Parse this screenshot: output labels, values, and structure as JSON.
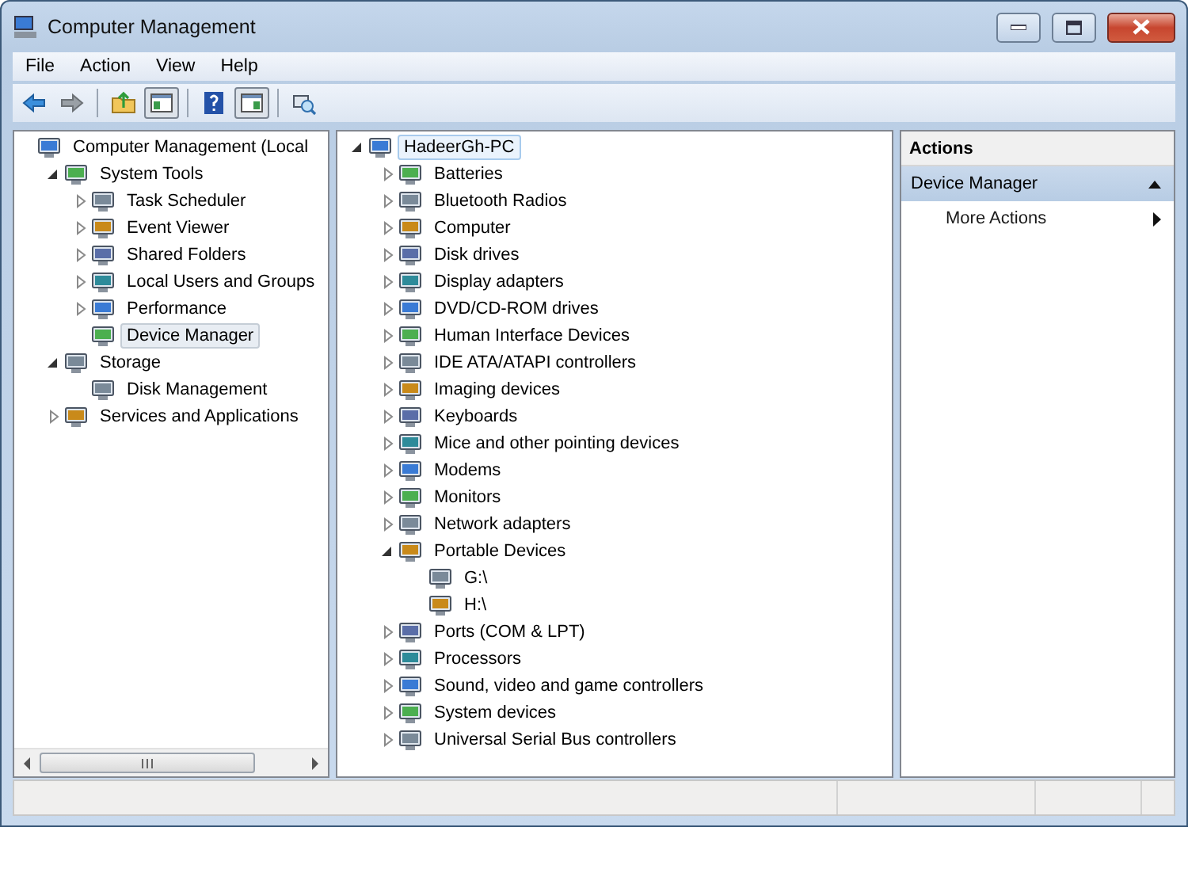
{
  "window": {
    "title": "Computer Management"
  },
  "menu": [
    "File",
    "Action",
    "View",
    "Help"
  ],
  "toolbar": [
    {
      "kind": "back",
      "pressed": false
    },
    {
      "kind": "forward",
      "pressed": false
    },
    {
      "kind": "sep"
    },
    {
      "kind": "up",
      "pressed": false
    },
    {
      "kind": "tree",
      "pressed": true
    },
    {
      "kind": "sep"
    },
    {
      "kind": "help",
      "pressed": false
    },
    {
      "kind": "action",
      "pressed": true
    },
    {
      "kind": "sep"
    },
    {
      "kind": "scan",
      "pressed": false
    }
  ],
  "console_tree": [
    {
      "label": "Computer Management (Local",
      "selected": false,
      "children": [
        {
          "label": "System Tools",
          "expanded": true,
          "selected": false,
          "children": [
            {
              "label": "Task Scheduler",
              "expanded": false,
              "selected": false
            },
            {
              "label": "Event Viewer",
              "expanded": false,
              "selected": false
            },
            {
              "label": "Shared Folders",
              "expanded": false,
              "selected": false
            },
            {
              "label": "Local Users and Groups",
              "expanded": false,
              "selected": false
            },
            {
              "label": "Performance",
              "expanded": false,
              "selected": false
            },
            {
              "label": "Device Manager",
              "selected": true
            }
          ]
        },
        {
          "label": "Storage",
          "expanded": true,
          "selected": false,
          "children": [
            {
              "label": "Disk Management",
              "selected": false
            }
          ]
        },
        {
          "label": "Services and Applications",
          "expanded": false,
          "selected": false
        }
      ]
    }
  ],
  "device_tree": [
    {
      "label": "HadeerGh-PC",
      "expanded": true,
      "selected": true,
      "children": [
        {
          "label": "Batteries",
          "expanded": false,
          "selected": false
        },
        {
          "label": "Bluetooth Radios",
          "expanded": false,
          "selected": false
        },
        {
          "label": "Computer",
          "expanded": false,
          "selected": false
        },
        {
          "label": "Disk drives",
          "expanded": false,
          "selected": false
        },
        {
          "label": "Display adapters",
          "expanded": false,
          "selected": false
        },
        {
          "label": "DVD/CD-ROM drives",
          "expanded": false,
          "selected": false
        },
        {
          "label": "Human Interface Devices",
          "expanded": false,
          "selected": false
        },
        {
          "label": "IDE ATA/ATAPI controllers",
          "expanded": false,
          "selected": false
        },
        {
          "label": "Imaging devices",
          "expanded": false,
          "selected": false
        },
        {
          "label": "Keyboards",
          "expanded": false,
          "selected": false
        },
        {
          "label": "Mice and other pointing devices",
          "expanded": false,
          "selected": false
        },
        {
          "label": "Modems",
          "expanded": false,
          "selected": false
        },
        {
          "label": "Monitors",
          "expanded": false,
          "selected": false
        },
        {
          "label": "Network adapters",
          "expanded": false,
          "selected": false
        },
        {
          "label": "Portable Devices",
          "expanded": true,
          "selected": false,
          "children": [
            {
              "label": "G:\\",
              "selected": false
            },
            {
              "label": "H:\\",
              "selected": false
            }
          ]
        },
        {
          "label": "Ports (COM & LPT)",
          "expanded": false,
          "selected": false
        },
        {
          "label": "Processors",
          "expanded": false,
          "selected": false
        },
        {
          "label": "Sound, video and game controllers",
          "expanded": false,
          "selected": false
        },
        {
          "label": "System devices",
          "expanded": false,
          "selected": false
        },
        {
          "label": "Universal Serial Bus controllers",
          "expanded": false,
          "selected": false
        }
      ]
    }
  ],
  "actions": {
    "title": "Actions",
    "section": "Device Manager",
    "items": [
      "More Actions"
    ]
  }
}
